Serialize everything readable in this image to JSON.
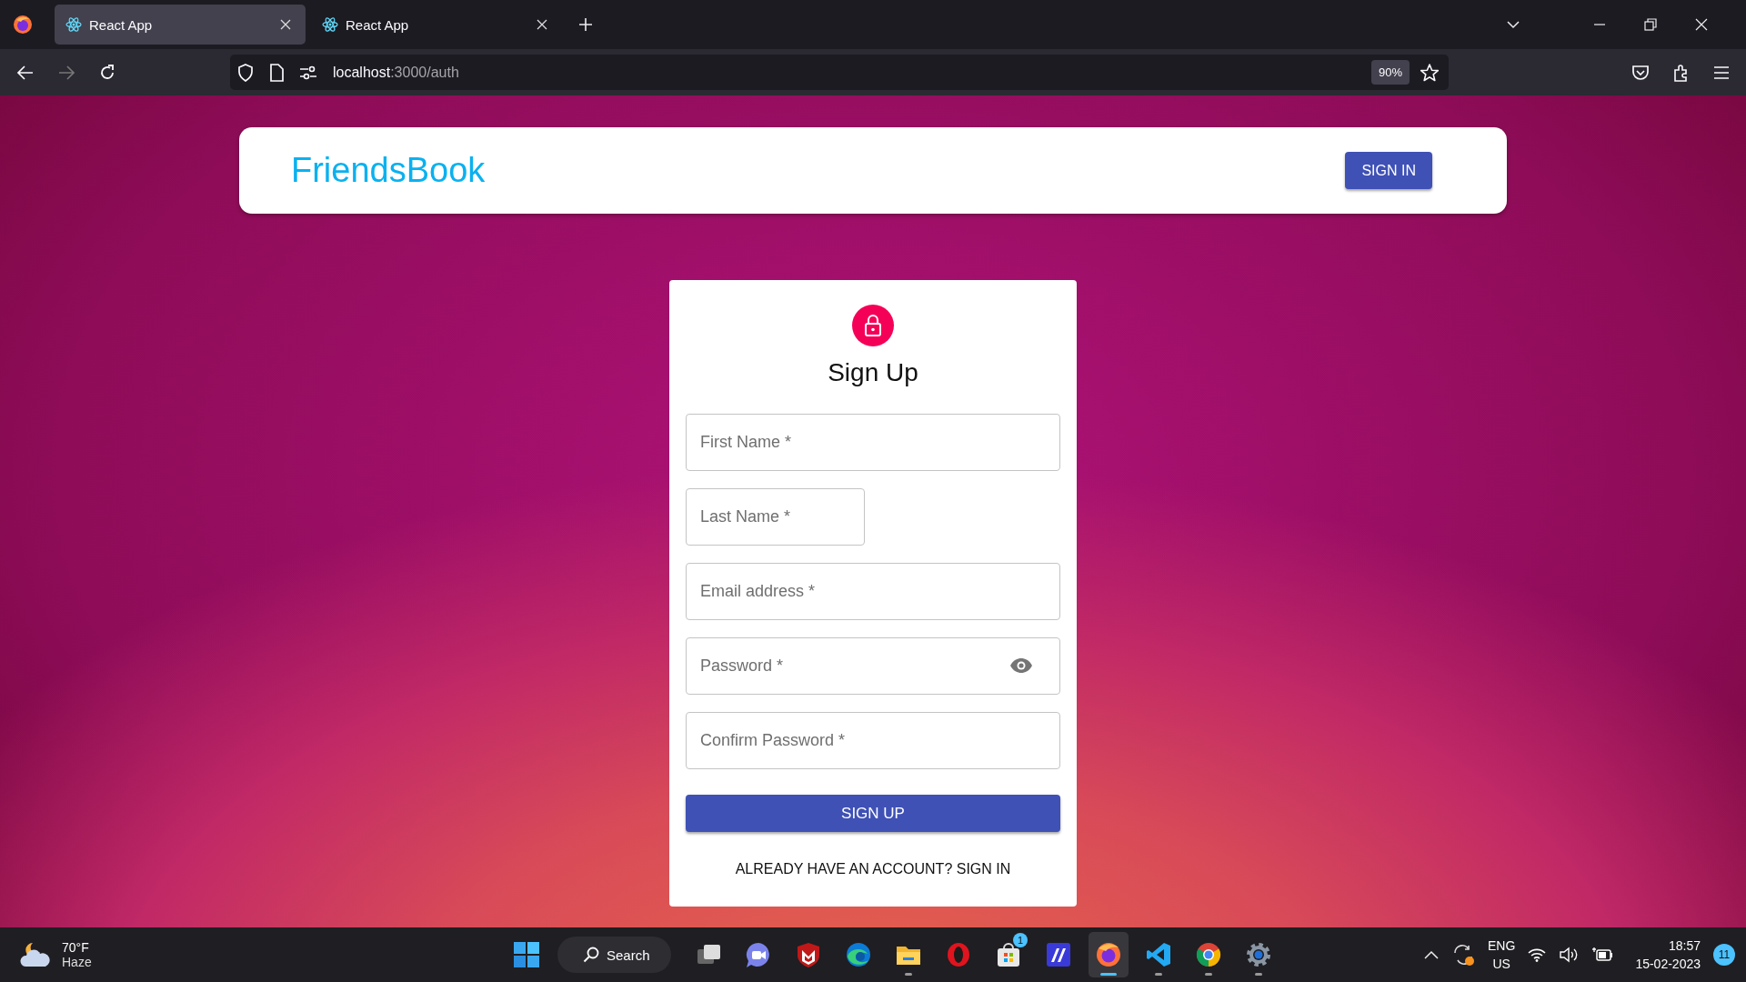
{
  "browser": {
    "tabs": [
      {
        "title": "React App",
        "selected": true
      },
      {
        "title": "React App",
        "selected": false
      }
    ],
    "nav": {
      "back_disabled": false,
      "forward_disabled": true
    },
    "url": {
      "host": "localhost",
      "path": ":3000/auth"
    },
    "zoom": "90%"
  },
  "header": {
    "brand": "FriendsBook",
    "button": "SIGN IN"
  },
  "form": {
    "title": "Sign Up",
    "fields": [
      {
        "kind": "full",
        "placeholder": "First Name *"
      },
      {
        "kind": "half",
        "placeholder": "Last Name *"
      },
      {
        "kind": "full",
        "placeholder": "Email address *"
      },
      {
        "kind": "password",
        "placeholder": "Password *"
      },
      {
        "kind": "full",
        "placeholder": "Confirm Password *"
      }
    ],
    "submit": "SIGN UP",
    "switch_link": "ALREADY HAVE AN ACCOUNT? SIGN IN"
  },
  "taskbar": {
    "weather": {
      "temperature": "70°F",
      "condition": "Haze"
    },
    "search": "Search",
    "apps": [
      {
        "kind": "task-view",
        "running": false,
        "selected": false
      },
      {
        "kind": "video-chat",
        "running": false,
        "selected": false
      },
      {
        "kind": "shield",
        "running": false,
        "selected": false
      },
      {
        "kind": "wave-browser",
        "running": false,
        "selected": false
      },
      {
        "kind": "folder",
        "running": true,
        "selected": false
      },
      {
        "kind": "ring",
        "running": false,
        "selected": false
      },
      {
        "kind": "store",
        "running": false,
        "selected": false,
        "badge": "1"
      },
      {
        "kind": "slash-tile",
        "running": false,
        "selected": false
      },
      {
        "kind": "fox",
        "running": true,
        "selected": true
      },
      {
        "kind": "code",
        "running": true,
        "selected": false
      },
      {
        "kind": "round-browser",
        "running": true,
        "selected": false
      },
      {
        "kind": "gear",
        "running": true,
        "selected": false
      }
    ],
    "language": "ENG",
    "region": "US",
    "time": "18:57",
    "date": "15-02-2023",
    "notifications": "11"
  }
}
